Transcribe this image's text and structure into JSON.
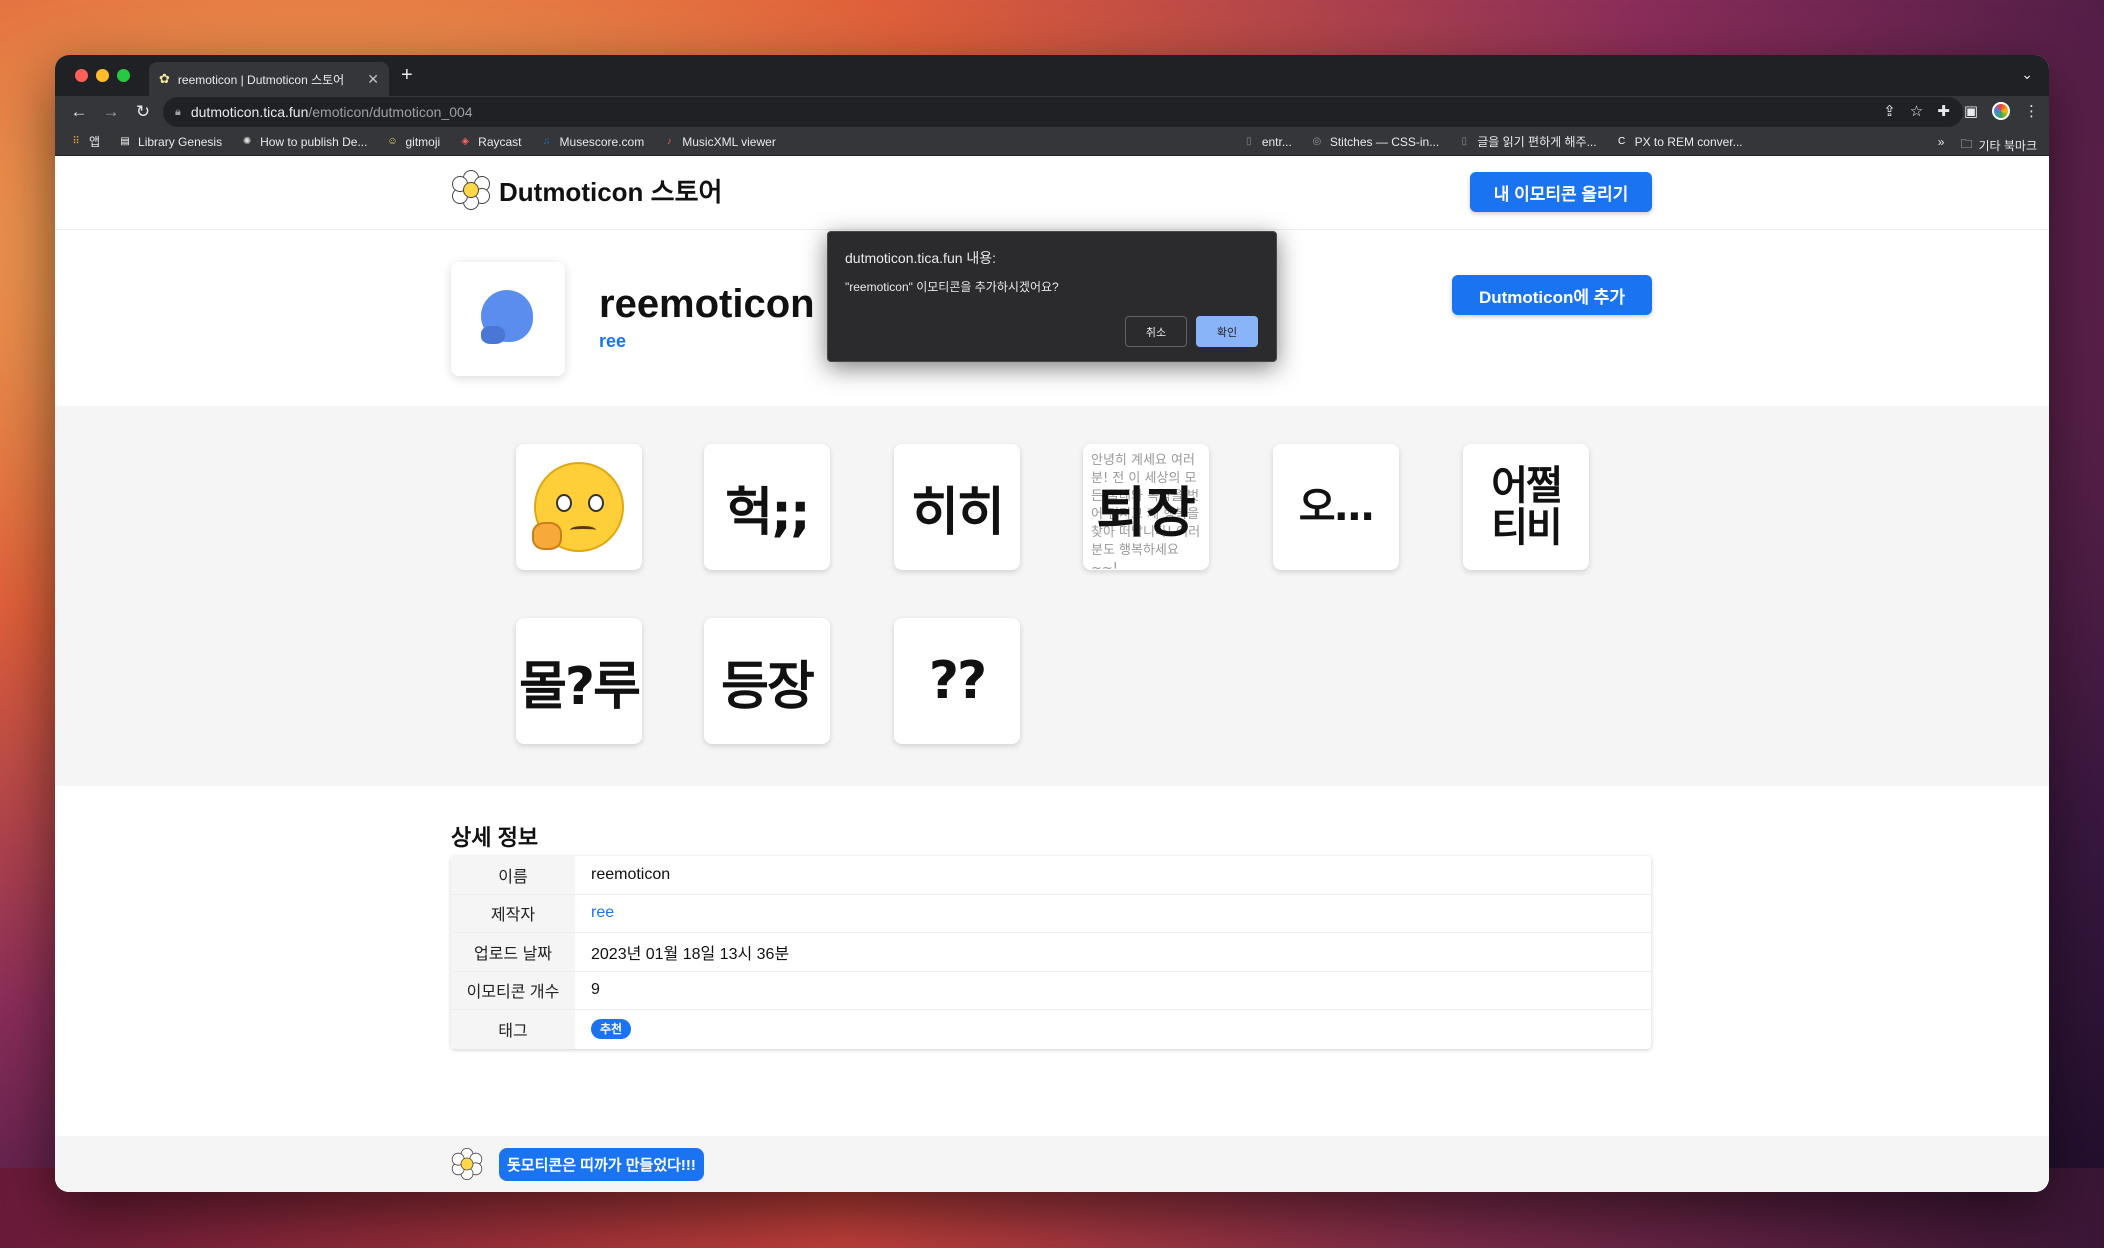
{
  "browser": {
    "tab_title": "reemoticon | Dutmoticon 스토어",
    "url_host": "dutmoticon.tica.fun",
    "url_path": "/emoticon/dutmoticon_004",
    "bookmarks": [
      {
        "label": "앱",
        "icon": "apps-grid-icon",
        "color": "#e8a33d"
      },
      {
        "label": "Library Genesis",
        "icon": "book-icon",
        "color": "#ffffff"
      },
      {
        "label": "How to publish De...",
        "icon": "brain-icon",
        "color": "#dddddd"
      },
      {
        "label": "gitmoji",
        "icon": "emoji-icon",
        "color": "#ffdd67"
      },
      {
        "label": "Raycast",
        "icon": "raycast-icon",
        "color": "#ff6363"
      },
      {
        "label": "Musescore.com",
        "icon": "musescore-icon",
        "color": "#1a70b8"
      },
      {
        "label": "MusicXML viewer",
        "icon": "music-icon",
        "color": "#e55"
      }
    ],
    "bookmarks_right": [
      {
        "label": "entr...",
        "icon": "page-icon",
        "color": "#888"
      },
      {
        "label": "Stitches — CSS-in...",
        "icon": "stitches-icon",
        "color": "#999"
      },
      {
        "label": "글을 읽기 편하게 해주...",
        "icon": "page-icon",
        "color": "#888"
      },
      {
        "label": "PX to REM conver...",
        "icon": "c-icon",
        "color": "#fff"
      }
    ],
    "other_bookmarks": "기타 북마크",
    "overflow": "»"
  },
  "site": {
    "brand": "Dutmoticon 스토어",
    "upload_button": "내 이모티콘 올리기"
  },
  "pack": {
    "title": "reemoticon",
    "author": "ree",
    "add_button": "Dutmoticon에 추가"
  },
  "emoticons": [
    {
      "kind": "think-emoji"
    },
    {
      "kind": "text",
      "text": "헉;;"
    },
    {
      "kind": "text",
      "text": "히히"
    },
    {
      "kind": "overlay",
      "text": "퇴장",
      "bg": "안녕히 계세요 여러분! 전 이 세상의 모든 굴레와 속박을 벗어 던지고 제 행복을 찾아 떠납니다! 여러분도 행복하세요~~!"
    },
    {
      "kind": "text",
      "text": "오..."
    },
    {
      "kind": "text",
      "text": "어쩔티비"
    },
    {
      "kind": "text",
      "text": "몰?루"
    },
    {
      "kind": "text",
      "text": "등장"
    },
    {
      "kind": "text",
      "text": "??"
    }
  ],
  "details": {
    "title": "상세 정보",
    "rows": [
      {
        "key": "이름",
        "value": "reemoticon"
      },
      {
        "key": "제작자",
        "value": "ree"
      },
      {
        "key": "업로드 날짜",
        "value": "2023년 01월 18일 13시 36분"
      },
      {
        "key": "이모티콘 개수",
        "value": "9"
      },
      {
        "key": "태그",
        "value": "추천"
      }
    ]
  },
  "footer": {
    "message": "돗모티콘은 띠까가 만들었다!!!"
  },
  "dialog": {
    "title": "dutmoticon.tica.fun 내용:",
    "message": "\"reemoticon\" 이모티콘을 추가하시겠어요?",
    "cancel": "취소",
    "ok": "확인"
  }
}
